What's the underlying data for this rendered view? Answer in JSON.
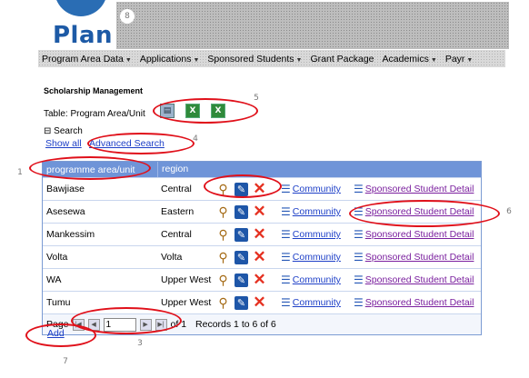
{
  "logo": {
    "text": "Plan"
  },
  "callouts": [
    "8",
    "2",
    "5",
    "4",
    "1",
    "6",
    "3",
    "7"
  ],
  "menu": {
    "items": [
      {
        "label": "Program Area Data",
        "has_arrow": true
      },
      {
        "label": "Applications",
        "has_arrow": true
      },
      {
        "label": "Sponsored Students",
        "has_arrow": true
      },
      {
        "label": "Grant Package",
        "has_arrow": false
      },
      {
        "label": "Academics",
        "has_arrow": true
      },
      {
        "label": "Payr",
        "has_arrow": true
      }
    ]
  },
  "page": {
    "heading": "Scholarship Management",
    "table_label": "Table: Program Area/Unit",
    "search_label": "Search",
    "show_all": "Show all",
    "advanced_search": "Advanced Search",
    "add": "Add"
  },
  "grid": {
    "columns": [
      "programme area/unit",
      "region"
    ],
    "rows": [
      {
        "area": "Bawjiase",
        "region": "Central"
      },
      {
        "area": "Asesewa",
        "region": "Eastern"
      },
      {
        "area": "Mankessim",
        "region": "Central"
      },
      {
        "area": "Volta",
        "region": "Volta"
      },
      {
        "area": "WA",
        "region": "Upper West"
      },
      {
        "area": "Tumu",
        "region": "Upper West"
      }
    ],
    "community_link": "Community",
    "sponsored_link": "Sponsored Student Detail",
    "pager": {
      "page_label": "Page",
      "page_value": "1",
      "of_label": "of 1",
      "records": "Records 1 to 6 of 6"
    }
  },
  "colors": {
    "header_bg": "#6f94d8",
    "link": "#1d3fc7",
    "visited_link": "#7a1f9e",
    "annotation": "#e0101a"
  }
}
